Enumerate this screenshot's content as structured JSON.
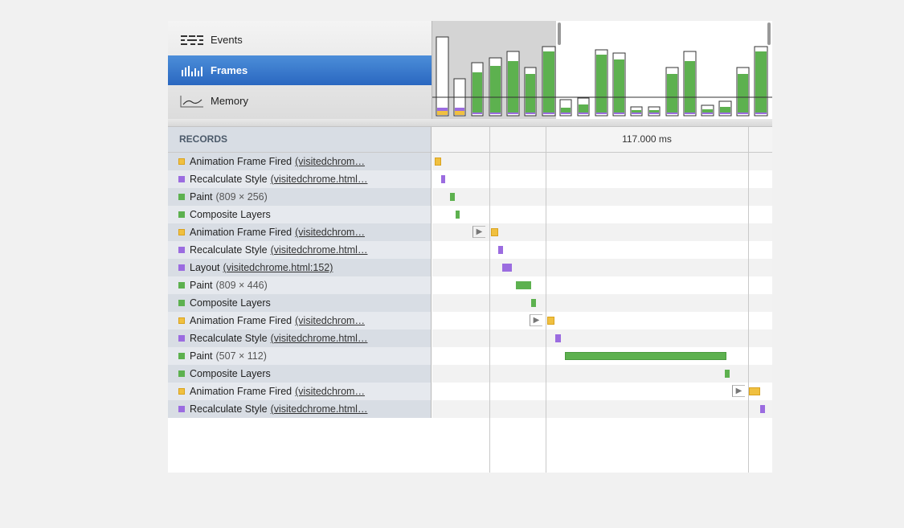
{
  "nav": {
    "items": [
      {
        "label": "Events",
        "icon": "events-icon",
        "selected": false
      },
      {
        "label": "Frames",
        "icon": "frames-icon",
        "selected": true
      },
      {
        "label": "Memory",
        "icon": "memory-icon",
        "selected": false
      }
    ]
  },
  "records": {
    "header": "RECORDS",
    "time_label": "117.000 ms",
    "rows": [
      {
        "type": "scripting",
        "title": "Animation Frame Fired",
        "link": "(visitedchrom…"
      },
      {
        "type": "rendering",
        "title": "Recalculate Style",
        "link": "(visitedchrome.html…"
      },
      {
        "type": "painting",
        "title": "Paint",
        "detail": "(809 × 256)"
      },
      {
        "type": "painting",
        "title": "Composite Layers"
      },
      {
        "type": "scripting",
        "title": "Animation Frame Fired",
        "link": "(visitedchrom…"
      },
      {
        "type": "rendering",
        "title": "Recalculate Style",
        "link": "(visitedchrome.html…"
      },
      {
        "type": "rendering",
        "title": "Layout",
        "link": "(visitedchrome.html:152)"
      },
      {
        "type": "painting",
        "title": "Paint",
        "detail": "(809 × 446)"
      },
      {
        "type": "painting",
        "title": "Composite Layers"
      },
      {
        "type": "scripting",
        "title": "Animation Frame Fired",
        "link": "(visitedchrom…"
      },
      {
        "type": "rendering",
        "title": "Recalculate Style",
        "link": "(visitedchrome.html…"
      },
      {
        "type": "painting",
        "title": "Paint",
        "detail": "(507 × 112)"
      },
      {
        "type": "painting",
        "title": "Composite Layers"
      },
      {
        "type": "scripting",
        "title": "Animation Frame Fired",
        "link": "(visitedchrom…"
      },
      {
        "type": "rendering",
        "title": "Recalculate Style",
        "link": "(visitedchrome.html…"
      }
    ]
  },
  "colors": {
    "scripting": "#f0c040",
    "rendering": "#9b6ce0",
    "painting": "#5db14f",
    "selected_nav": "#2a67c0"
  }
}
